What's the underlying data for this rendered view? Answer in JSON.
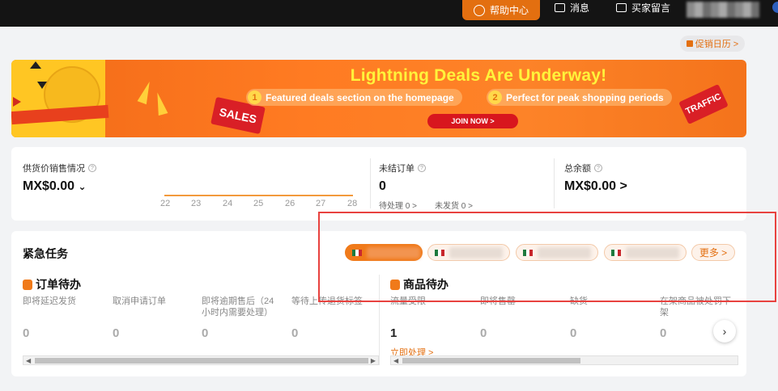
{
  "topbar": {
    "help_label": "帮助中心",
    "messages_label": "消息",
    "buyer_messages_label": "买家留言"
  },
  "calendar_chip": "促销日历 >",
  "banner": {
    "title": "Lightning Deals Are Underway!",
    "point1_num": "1",
    "point1": "Featured deals section on the homepage",
    "point2_num": "2",
    "point2": "Perfect for peak shopping periods",
    "join_label": "JOIN NOW >",
    "sales_tag": "SALES",
    "traffic_tag": "TRAFFIC"
  },
  "stats": {
    "supply_label": "供货价销售情况",
    "supply_value": "MX$0.00",
    "chart_ticks": [
      "22",
      "23",
      "24",
      "25",
      "26",
      "27",
      "28"
    ],
    "open_orders_label": "未结订单",
    "open_orders_value": "0",
    "pending_label": "待处理 0 >",
    "unshipped_label": "未发货 0 >",
    "balance_label": "总余额",
    "balance_value": "MX$0.00 >"
  },
  "tasks": {
    "title": "紧急任务",
    "more_label": "更多 >",
    "orders_title": "订单待办",
    "orders": [
      {
        "label": "即将延迟发货",
        "value": "0"
      },
      {
        "label": "取消申请订单",
        "value": "0"
      },
      {
        "label": "即将逾期售后（24小时内需要处理）",
        "value": "0"
      },
      {
        "label": "等待上传退货标签",
        "value": "0"
      }
    ],
    "products_title": "商品待办",
    "products": [
      {
        "label": "流量受限",
        "value": "1"
      },
      {
        "label": "即将售罄",
        "value": "0"
      },
      {
        "label": "缺货",
        "value": "0"
      },
      {
        "label": "在架商品被处罚下架",
        "value": "0"
      }
    ],
    "act_link": "立即处理 >"
  },
  "colors": {
    "accent": "#e36f10",
    "highlight_frame": "#e8423f"
  }
}
